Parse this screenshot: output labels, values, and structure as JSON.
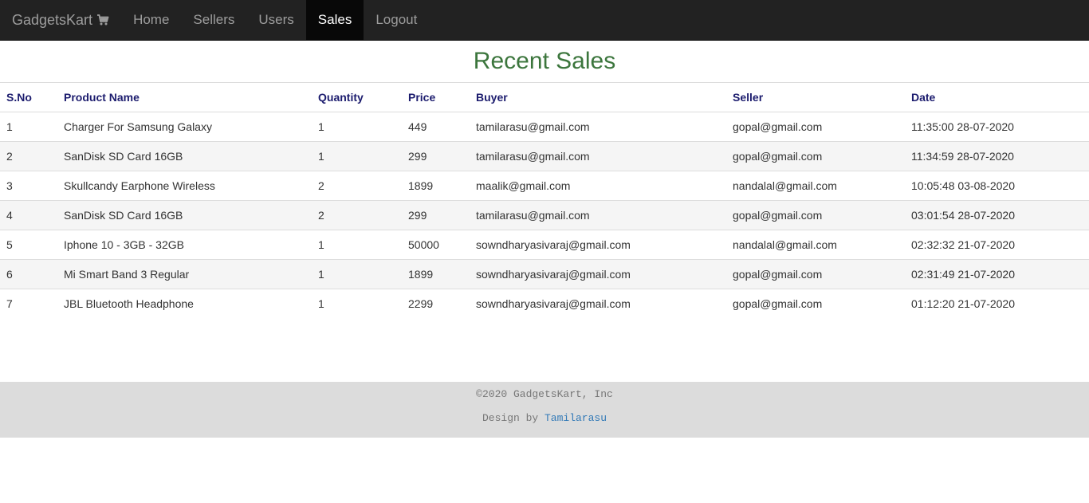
{
  "navbar": {
    "brand": "GadgetsKart",
    "brand_icon": "cart-icon",
    "items": [
      {
        "label": "Home",
        "active": false
      },
      {
        "label": "Sellers",
        "active": false
      },
      {
        "label": "Users",
        "active": false
      },
      {
        "label": "Sales",
        "active": true
      },
      {
        "label": "Logout",
        "active": false
      }
    ]
  },
  "page": {
    "title": "Recent Sales"
  },
  "table": {
    "headers": [
      "S.No",
      "Product Name",
      "Quantity",
      "Price",
      "Buyer",
      "Seller",
      "Date"
    ],
    "rows": [
      [
        "1",
        "Charger For Samsung Galaxy",
        "1",
        "449",
        "tamilarasu@gmail.com",
        "gopal@gmail.com",
        "11:35:00 28-07-2020"
      ],
      [
        "2",
        "SanDisk SD Card 16GB",
        "1",
        "299",
        "tamilarasu@gmail.com",
        "gopal@gmail.com",
        "11:34:59 28-07-2020"
      ],
      [
        "3",
        "Skullcandy Earphone Wireless",
        "2",
        "1899",
        "maalik@gmail.com",
        "nandalal@gmail.com",
        "10:05:48 03-08-2020"
      ],
      [
        "4",
        "SanDisk SD Card 16GB",
        "2",
        "299",
        "tamilarasu@gmail.com",
        "gopal@gmail.com",
        "03:01:54 28-07-2020"
      ],
      [
        "5",
        "Iphone 10 - 3GB - 32GB",
        "1",
        "50000",
        "sowndharyasivaraj@gmail.com",
        "nandalal@gmail.com",
        "02:32:32 21-07-2020"
      ],
      [
        "6",
        "Mi Smart Band 3 Regular",
        "1",
        "1899",
        "sowndharyasivaraj@gmail.com",
        "gopal@gmail.com",
        "02:31:49 21-07-2020"
      ],
      [
        "7",
        "JBL Bluetooth Headphone",
        "1",
        "2299",
        "sowndharyasivaraj@gmail.com",
        "gopal@gmail.com",
        "01:12:20 21-07-2020"
      ]
    ]
  },
  "footer": {
    "copyright": "©2020 GadgetsKart, Inc",
    "design_prefix": "Design by ",
    "designer": "Tamilarasu"
  },
  "colors": {
    "navbar_bg": "#222222",
    "title_green": "#3c763d",
    "header_navy": "#1c1c6e",
    "footer_bg": "#dcdcdc",
    "link_blue": "#337ab7"
  }
}
